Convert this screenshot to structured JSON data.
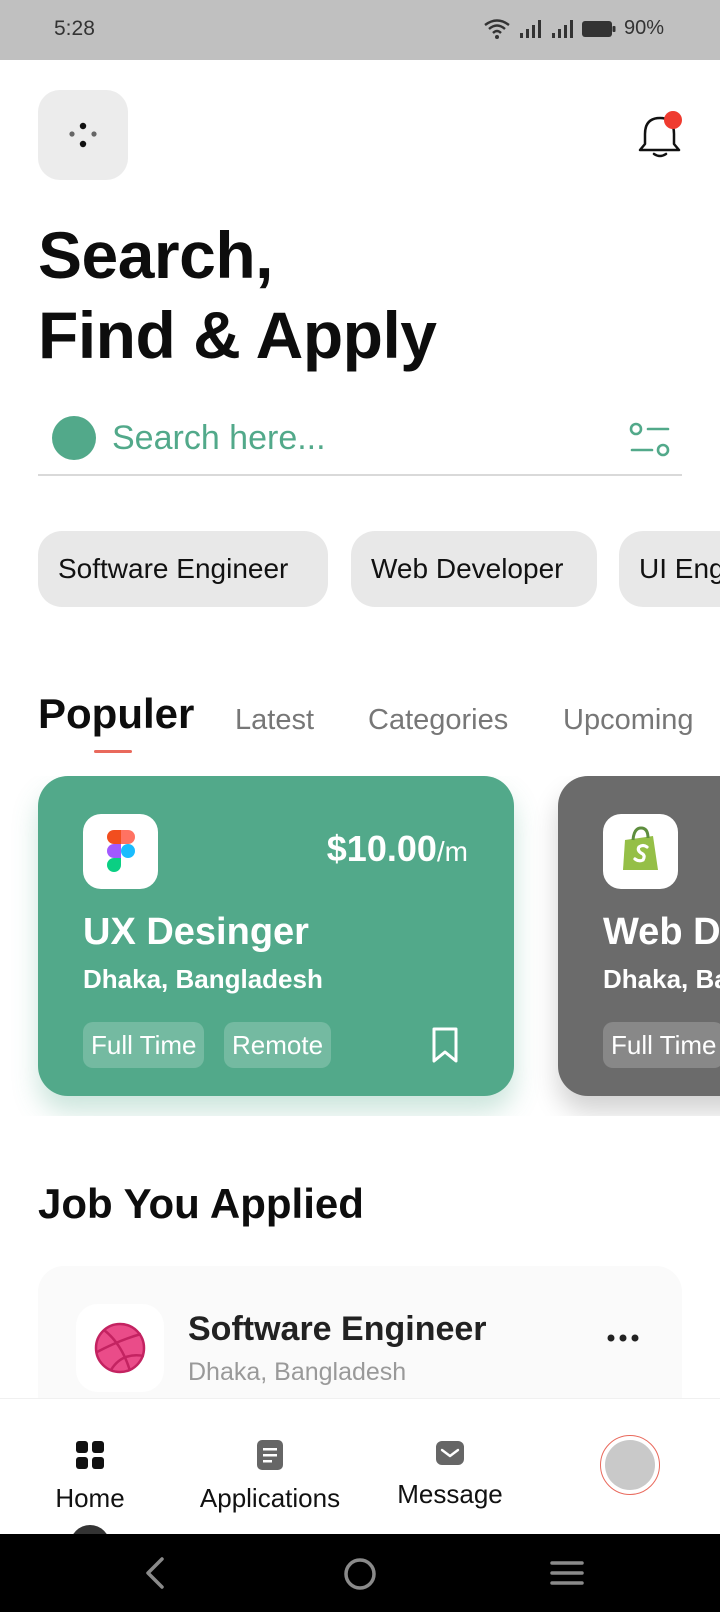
{
  "status_bar": {
    "time": "5:28",
    "battery": "90%"
  },
  "header": {
    "headline_line1": "Search,",
    "headline_line2": "Find & Apply"
  },
  "search": {
    "placeholder": "Search here...",
    "accent_color": "#52a98a"
  },
  "chips": [
    "Software Engineer",
    "Web Developer",
    "UI Eng"
  ],
  "tabs": {
    "active": "Populer",
    "others": [
      "Latest",
      "Categories",
      "Upcoming"
    ],
    "indicator_color": "#e9695c"
  },
  "job_cards": [
    {
      "title": "UX Desinger",
      "location": "Dhaka, Bangladesh",
      "price": "$10.00",
      "price_unit": "/m",
      "tags": [
        "Full Time",
        "Remote"
      ],
      "logo": "figma-logo",
      "bg_color": "#52a98a"
    },
    {
      "title": "Web De",
      "location": "Dhaka, Ba",
      "tags": [
        "Full Time"
      ],
      "logo": "shopify-logo",
      "bg_color": "#6b6b6b"
    }
  ],
  "applied": {
    "section_title": "Job You Applied",
    "items": [
      {
        "title": "Software Engineer",
        "location": "Dhaka, Bangladesh",
        "logo": "dribbble-logo"
      }
    ]
  },
  "bottom_nav": {
    "items": [
      {
        "label": "Home",
        "icon": "grid-icon"
      },
      {
        "label": "Applications",
        "icon": "document-icon"
      },
      {
        "label": "Message",
        "icon": "mail-icon"
      }
    ]
  }
}
